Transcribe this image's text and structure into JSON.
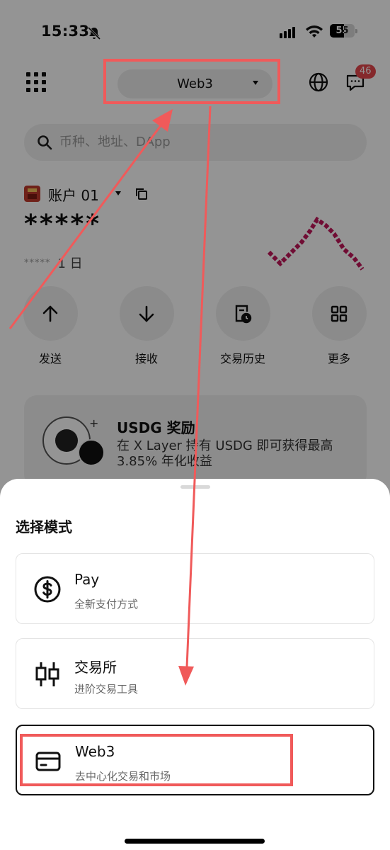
{
  "status_bar": {
    "time": "15:33",
    "battery": "55"
  },
  "header": {
    "mode_label": "Web3",
    "notification_count": "46"
  },
  "search": {
    "placeholder": "币种、地址、DApp"
  },
  "account": {
    "name": "账户 01",
    "balance_masked": "*****",
    "change_masked": "*****",
    "range": "1 日"
  },
  "actions": [
    {
      "label": "发送",
      "icon": "arrow-up-icon"
    },
    {
      "label": "接收",
      "icon": "arrow-down-icon"
    },
    {
      "label": "交易历史",
      "icon": "history-icon"
    },
    {
      "label": "更多",
      "icon": "grid-icon"
    }
  ],
  "promo": {
    "title": "USDG 奖励",
    "description": "在 X Layer 持有 USDG 即可获得最高 3.85% 年化收益"
  },
  "sheet": {
    "title": "选择模式",
    "options": [
      {
        "title": "Pay",
        "subtitle": "全新支付方式",
        "icon": "dollar-circle-icon"
      },
      {
        "title": "交易所",
        "subtitle": "进阶交易工具",
        "icon": "candlestick-icon"
      },
      {
        "title": "Web3",
        "subtitle": "去中心化交易和市场",
        "icon": "wallet-card-icon",
        "selected": true
      }
    ]
  },
  "colors": {
    "annotation": "#f05a5a",
    "badge": "#e5484d",
    "chart_pink": "#c2185b"
  }
}
